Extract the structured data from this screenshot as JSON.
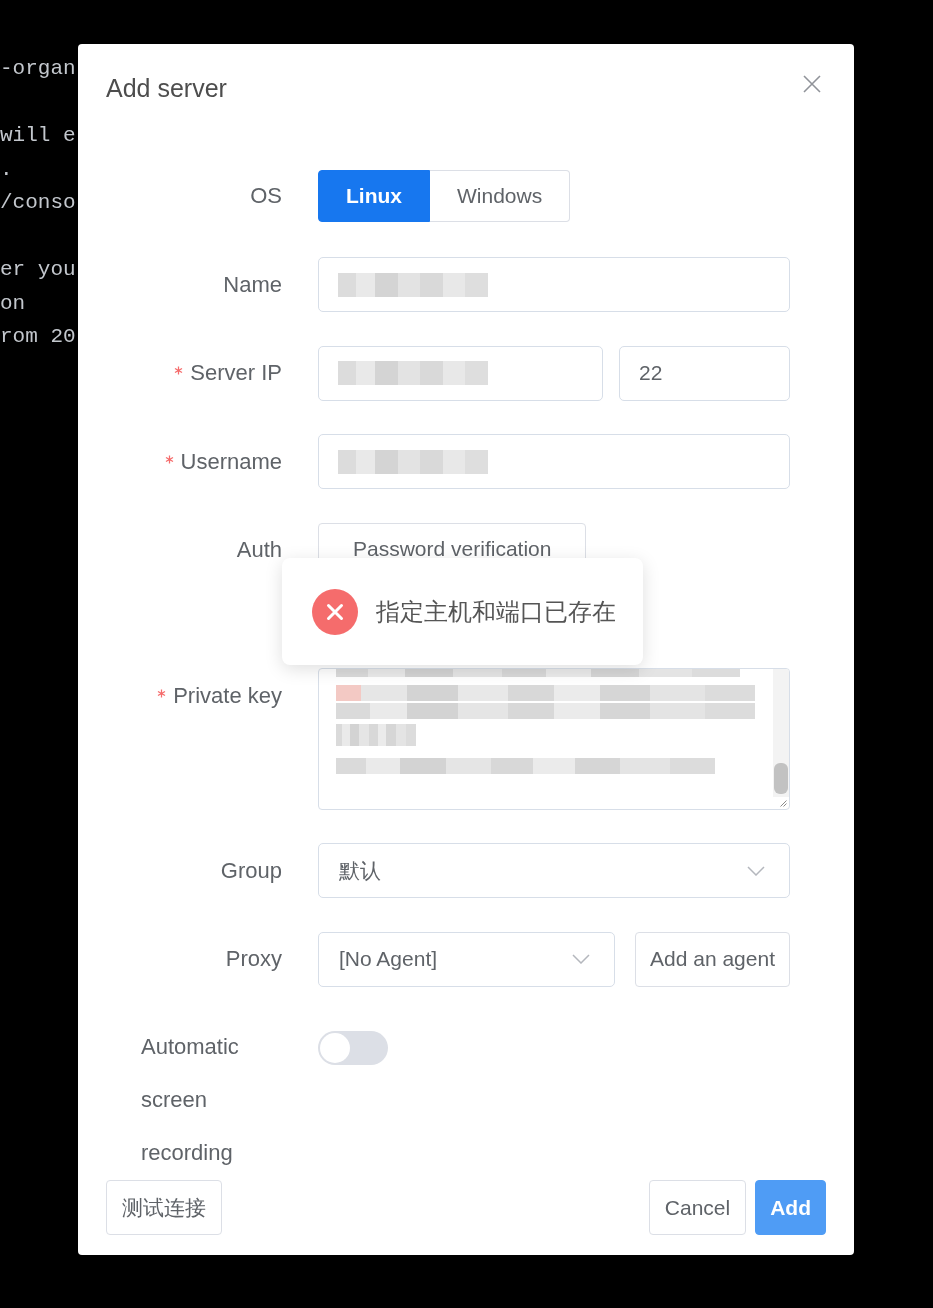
{
  "terminal": {
    "blocks": [
      [
        "-organ"
      ],
      [
        "will e",
        ".",
        "/conso"
      ],
      [
        "er you",
        "on",
        "rom 20"
      ]
    ]
  },
  "dialog": {
    "title": "Add server",
    "form": {
      "rows": [
        {
          "kind": "segmented",
          "label": "OS",
          "required": false,
          "options": [
            {
              "label": "Linux",
              "selected": true
            },
            {
              "label": "Windows",
              "selected": false
            }
          ]
        },
        {
          "kind": "input",
          "label": "Name",
          "required": false,
          "inputs": [
            {
              "blurred": true
            }
          ]
        },
        {
          "kind": "input",
          "label": "Server IP",
          "required": true,
          "inputs": [
            {
              "blurred": true
            },
            {
              "value": "22",
              "blurred": false
            }
          ]
        },
        {
          "kind": "input",
          "label": "Username",
          "required": true,
          "inputs": [
            {
              "blurred": true
            }
          ]
        },
        {
          "kind": "options",
          "label": "Auth",
          "required": false,
          "options": [
            {
              "label": "Password verification",
              "selected": false
            }
          ]
        },
        {
          "kind": "textarea",
          "label": "Private key",
          "required": true,
          "blurred": true
        },
        {
          "kind": "select",
          "label": "Group",
          "required": false,
          "value": "默认"
        },
        {
          "kind": "select",
          "label": "Proxy",
          "required": false,
          "value": "[No Agent]",
          "button": "Add an agent"
        },
        {
          "kind": "switch",
          "label": "Automatic screen recording",
          "required": false,
          "on": false
        }
      ]
    },
    "footer": {
      "test": "测试连接",
      "cancel": "Cancel",
      "confirm": "Add"
    }
  },
  "toast": {
    "kind": "error",
    "text": "指定主机和端口已存在"
  }
}
